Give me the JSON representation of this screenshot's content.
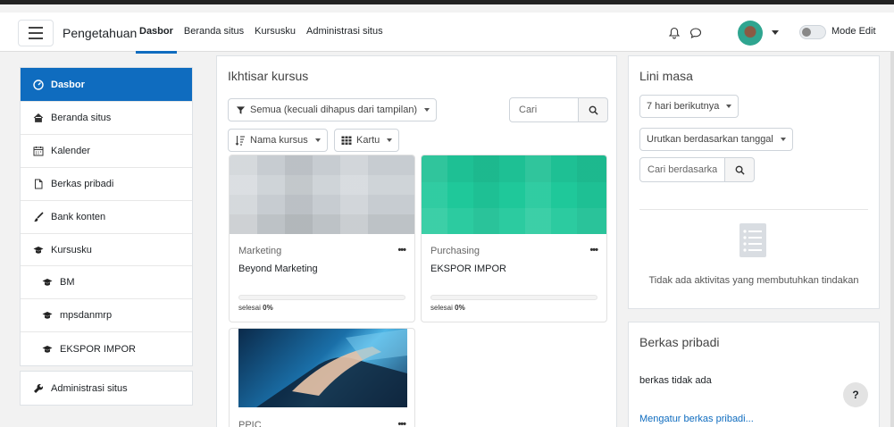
{
  "navbar": {
    "brand": "Pengetahuan",
    "links": [
      {
        "label": "Dasbor",
        "active": true
      },
      {
        "label": "Beranda situs",
        "active": false
      },
      {
        "label": "Kursusku",
        "active": false
      },
      {
        "label": "Administrasi situs",
        "active": false
      }
    ],
    "mode_edit": "Mode Edit"
  },
  "sidebar": {
    "items": [
      {
        "label": "Dasbor",
        "icon": "dashboard-icon"
      },
      {
        "label": "Beranda situs",
        "icon": "home-icon"
      },
      {
        "label": "Kalender",
        "icon": "calendar-icon"
      },
      {
        "label": "Berkas pribadi",
        "icon": "file-icon"
      },
      {
        "label": "Bank konten",
        "icon": "brush-icon"
      },
      {
        "label": "Kursusku",
        "icon": "graduation-cap-icon"
      },
      {
        "label": "BM",
        "icon": "graduation-cap-icon"
      },
      {
        "label": "mpsdanmrp",
        "icon": "graduation-cap-icon"
      },
      {
        "label": "EKSPOR IMPOR",
        "icon": "graduation-cap-icon"
      }
    ],
    "admin": {
      "label": "Administrasi situs",
      "icon": "wrench-icon"
    }
  },
  "overview": {
    "title": "Ikhtisar kursus",
    "filter_label": "Semua (kecuali dihapus dari tampilan)",
    "search_placeholder": "Cari",
    "sort_label": "Nama kursus",
    "view_label": "Kartu",
    "courses": [
      {
        "category": "Marketing",
        "name": "Beyond Marketing",
        "progress_prefix": "selesai ",
        "progress": "0%"
      },
      {
        "category": "Purchasing",
        "name": "EKSPOR IMPOR",
        "progress_prefix": "selesai ",
        "progress": "0%"
      },
      {
        "category": "PPIC",
        "name": "",
        "progress_prefix": "",
        "progress": ""
      }
    ],
    "more_label": "•••"
  },
  "timeline": {
    "title": "Lini masa",
    "range_label": "7 hari berikutnya",
    "sort_label": "Urutkan berdasarkan tanggal",
    "search_placeholder": "Cari berdasarka",
    "empty_text": "Tidak ada aktivitas yang membutuhkan tindakan"
  },
  "files": {
    "title": "Berkas pribadi",
    "empty_text": "berkas tidak ada",
    "manage_link": "Mengatur berkas pribadi..."
  },
  "help_label": "?"
}
